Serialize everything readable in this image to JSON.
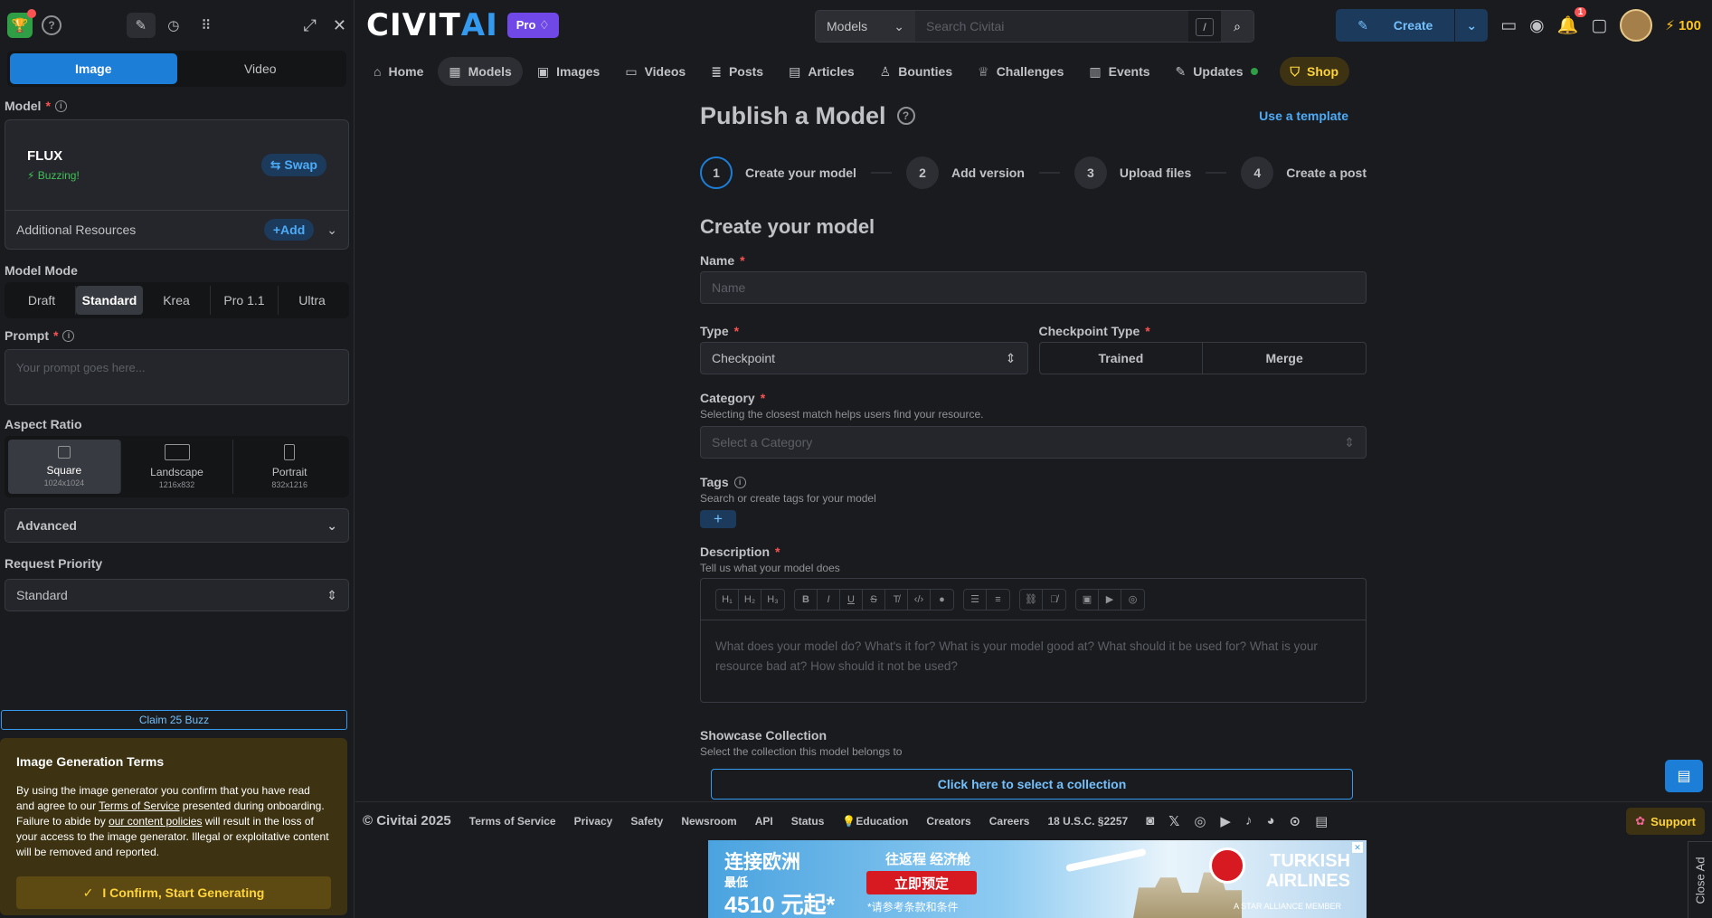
{
  "sidebar": {
    "tabs": [
      {
        "label": "Image"
      },
      {
        "label": "Video"
      }
    ],
    "model_label": "Model",
    "model_name": "FLUX",
    "model_status": "Buzzing!",
    "swap_label": "Swap",
    "additional_resources_label": "Additional Resources",
    "add_label": "Add",
    "model_mode_label": "Model Mode",
    "model_modes": [
      {
        "label": "Draft"
      },
      {
        "label": "Standard"
      },
      {
        "label": "Krea"
      },
      {
        "label": "Pro 1.1"
      },
      {
        "label": "Ultra"
      }
    ],
    "selected_mode": "Standard",
    "prompt_label": "Prompt",
    "prompt_placeholder": "Your prompt goes here...",
    "aspect_ratio_label": "Aspect Ratio",
    "aspect_ratios": [
      {
        "label": "Square",
        "size": "1024x1024"
      },
      {
        "label": "Landscape",
        "size": "1216x832"
      },
      {
        "label": "Portrait",
        "size": "832x1216"
      }
    ],
    "advanced_label": "Advanced",
    "request_priority_label": "Request Priority",
    "request_priority_value": "Standard",
    "claim_label": "Claim 25 Buzz",
    "terms": {
      "title": "Image Generation Terms",
      "text_1": "By using the image generator you confirm that you have read and agree to our ",
      "link_1": "Terms of Service",
      "text_2": " presented during onboarding. Failure to abide by ",
      "link_2": "our content policies",
      "text_3": " will result in the loss of your access to the image generator. Illegal or exploitative content will be removed and reported.",
      "confirm_label": "I Confirm, Start Generating"
    }
  },
  "header": {
    "brand_a": "CIVIT",
    "brand_b": "AI",
    "pro_label": "Pro",
    "search_scope": "Models",
    "search_placeholder": "Search Civitai",
    "search_shortcut": "/",
    "create_label": "Create",
    "notification_count": "1",
    "buzz_count": "100"
  },
  "nav": [
    {
      "label": "Home",
      "icon": "⌂"
    },
    {
      "label": "Models",
      "icon": "▦"
    },
    {
      "label": "Images",
      "icon": "▣"
    },
    {
      "label": "Videos",
      "icon": "▭"
    },
    {
      "label": "Posts",
      "icon": "≣"
    },
    {
      "label": "Articles",
      "icon": "▤"
    },
    {
      "label": "Bounties",
      "icon": "♙"
    },
    {
      "label": "Challenges",
      "icon": "♕"
    },
    {
      "label": "Events",
      "icon": "▥"
    },
    {
      "label": "Updates",
      "icon": "✎"
    }
  ],
  "nav_shop": "Shop",
  "main": {
    "page_title": "Publish a Model",
    "use_template": "Use a template",
    "steps": [
      {
        "num": "1",
        "label": "Create your model"
      },
      {
        "num": "2",
        "label": "Add version"
      },
      {
        "num": "3",
        "label": "Upload files"
      },
      {
        "num": "4",
        "label": "Create a post"
      }
    ],
    "section_title": "Create your model",
    "name_label": "Name",
    "name_placeholder": "Name",
    "type_label": "Type",
    "type_value": "Checkpoint",
    "checkpoint_type_label": "Checkpoint Type",
    "checkpoint_options": [
      {
        "label": "Trained"
      },
      {
        "label": "Merge"
      }
    ],
    "category_label": "Category",
    "category_desc": "Selecting the closest match helps users find your resource.",
    "category_placeholder": "Select a Category",
    "tags_label": "Tags",
    "tags_desc": "Search or create tags for your model",
    "description_label": "Description",
    "description_desc": "Tell us what your model does",
    "description_placeholder": "What does your model do? What's it for? What is your model good at? What should it be used for? What is your resource bad at? How should it not be used?",
    "showcase_label": "Showcase Collection",
    "showcase_desc": "Select the collection this model belongs to",
    "showcase_button": "Click here to select a collection"
  },
  "footer": {
    "copyright": "© Civitai 2025",
    "links": [
      {
        "label": "Terms of Service"
      },
      {
        "label": "Privacy"
      },
      {
        "label": "Safety"
      },
      {
        "label": "Newsroom"
      },
      {
        "label": "API"
      },
      {
        "label": "Status"
      },
      {
        "label": "Education"
      },
      {
        "label": "Creators"
      },
      {
        "label": "Careers"
      },
      {
        "label": "18 U.S.C. §2257"
      }
    ],
    "support_label": "Support"
  },
  "ad": {
    "line1": "连接欧洲",
    "line2": "最低",
    "line3": "4510 元起*",
    "line4": "往返程 经济舱",
    "cta": "立即预定",
    "fine": "*请参考条款和条件",
    "airline_1": "TURKISH",
    "airline_2": "AIRLINES",
    "alliance": "A STAR ALLIANCE MEMBER"
  },
  "close_ad_label": "Close Ad"
}
